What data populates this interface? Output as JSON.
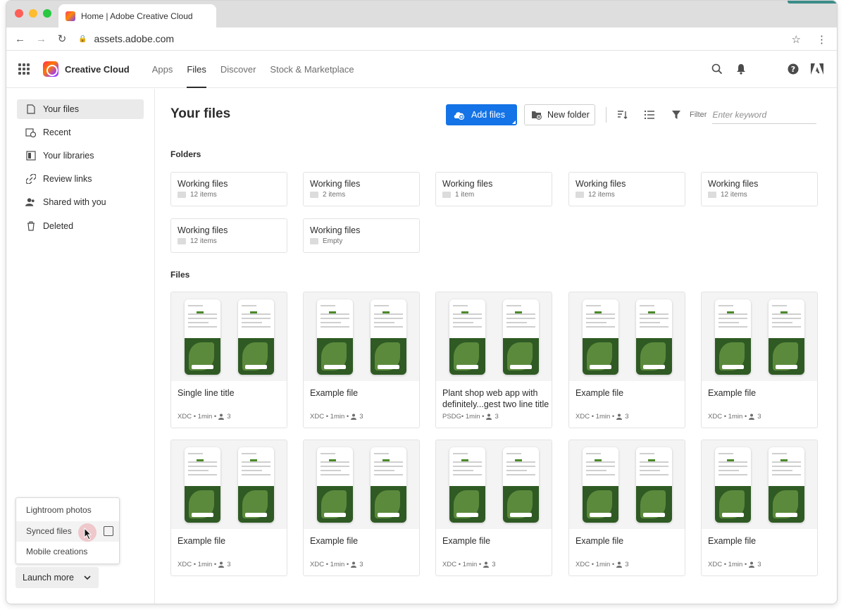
{
  "browser": {
    "tab_title": "Home | Adobe Creative Cloud",
    "url": "assets.adobe.com"
  },
  "header": {
    "brand": "Creative Cloud",
    "nav": [
      "Apps",
      "Files",
      "Discover",
      "Stock & Marketplace"
    ],
    "active_nav": "Files"
  },
  "sidebar": {
    "items": [
      {
        "label": "Your files",
        "icon": "file-icon"
      },
      {
        "label": "Recent",
        "icon": "recent-icon"
      },
      {
        "label": "Your libraries",
        "icon": "library-icon"
      },
      {
        "label": "Review links",
        "icon": "link-icon"
      },
      {
        "label": "Shared with you",
        "icon": "people-icon"
      },
      {
        "label": "Deleted",
        "icon": "trash-icon"
      }
    ],
    "launch_menu": [
      "Lightroom photos",
      "Synced files",
      "Mobile creations"
    ],
    "launch_button": "Launch more"
  },
  "main": {
    "title": "Your files",
    "add_files": "Add files",
    "new_folder": "New folder",
    "filter_label": "Filter",
    "filter_placeholder": "Enter keyword",
    "folders_label": "Folders",
    "files_label": "Files",
    "folders": [
      {
        "name": "Working files",
        "count": "12 items"
      },
      {
        "name": "Working files",
        "count": "2 items"
      },
      {
        "name": "Working files",
        "count": "1 item"
      },
      {
        "name": "Working files",
        "count": "12 items"
      },
      {
        "name": "Working files",
        "count": "12 items"
      },
      {
        "name": "Working files",
        "count": "12 items"
      },
      {
        "name": "Working files",
        "count": "Empty"
      }
    ],
    "files": [
      {
        "title": "Single line title",
        "meta": "XDC • 1min •",
        "shared": "3"
      },
      {
        "title": "Example file",
        "meta": "XDC • 1min •",
        "shared": "3"
      },
      {
        "title": "Plant shop web app with definitely...gest two line title",
        "meta": "PSDG• 1min •",
        "shared": "3"
      },
      {
        "title": "Example file",
        "meta": "XDC • 1min •",
        "shared": "3"
      },
      {
        "title": "Example file",
        "meta": "XDC • 1min •",
        "shared": "3"
      },
      {
        "title": "Example file",
        "meta": "XDC • 1min •",
        "shared": "3"
      },
      {
        "title": "Example file",
        "meta": "XDC • 1min •",
        "shared": "3"
      },
      {
        "title": "Example file",
        "meta": "XDC • 1min •",
        "shared": "3"
      },
      {
        "title": "Example file",
        "meta": "XDC • 1min •",
        "shared": "3"
      },
      {
        "title": "Example file",
        "meta": "XDC • 1min •",
        "shared": "3"
      }
    ]
  },
  "colors": {
    "accent": "#1473e6",
    "leaf": "#2f5a24"
  }
}
